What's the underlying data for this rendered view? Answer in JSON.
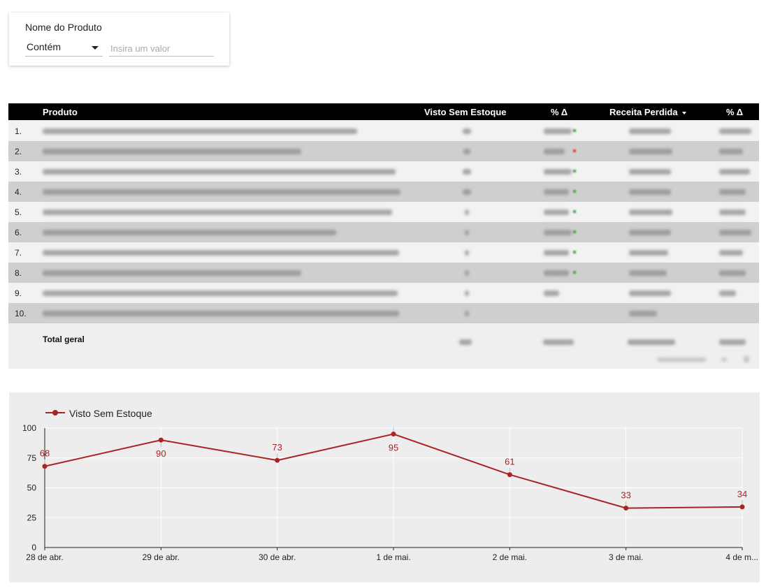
{
  "filter": {
    "title": "Nome do Produto",
    "operator": "Contém",
    "placeholder": "Insira um valor"
  },
  "table": {
    "headers": {
      "produto": "Produto",
      "visto": "Visto Sem Estoque",
      "pct1": "% Δ",
      "receita": "Receita Perdida",
      "pct2": "% Δ"
    },
    "rows": [
      {
        "num": "1."
      },
      {
        "num": "2."
      },
      {
        "num": "3."
      },
      {
        "num": "4."
      },
      {
        "num": "5."
      },
      {
        "num": "6."
      },
      {
        "num": "7."
      },
      {
        "num": "8."
      },
      {
        "num": "9."
      },
      {
        "num": "10."
      }
    ],
    "total_label": "Total geral",
    "colors": {
      "header_bg": "#000000",
      "row_even": "#cfcfcf",
      "row_odd": "#f2f2f2"
    }
  },
  "chart_data": {
    "type": "line",
    "categories": [
      "28 de abr.",
      "29 de abr.",
      "30 de abr.",
      "1 de mai.",
      "2 de mai.",
      "3 de mai.",
      "4 de m..."
    ],
    "series": [
      {
        "name": "Visto Sem Estoque",
        "values": [
          68,
          90,
          73,
          95,
          61,
          33,
          34
        ],
        "color": "#a82424"
      }
    ],
    "y_ticks": [
      0,
      25,
      50,
      75,
      100
    ],
    "ylim": [
      0,
      100
    ],
    "grid": true,
    "legend_position": "top-left",
    "data_labels": true
  }
}
